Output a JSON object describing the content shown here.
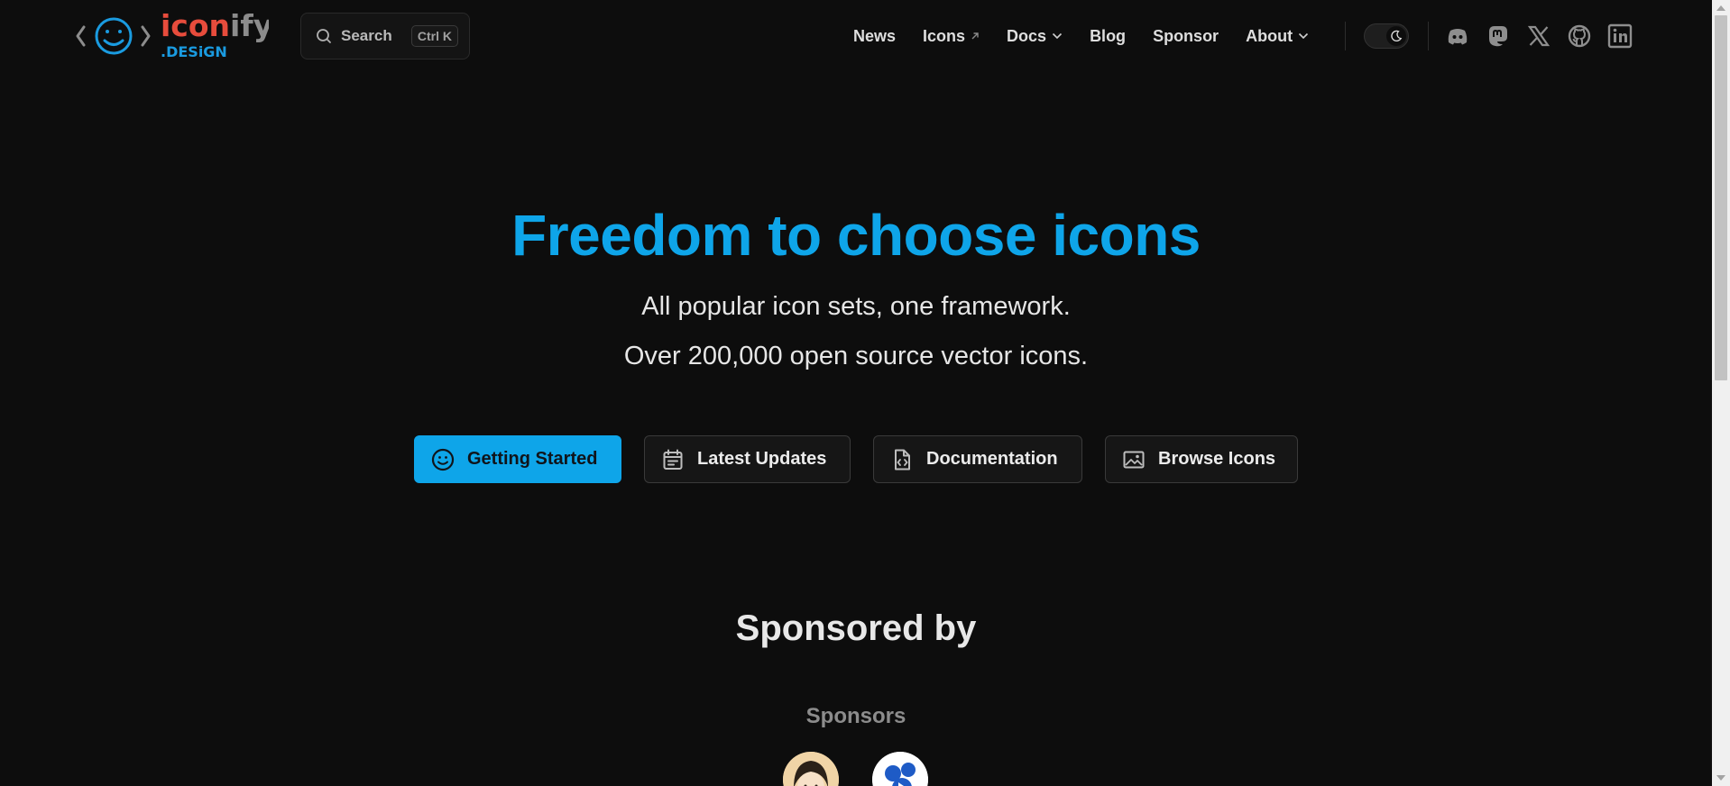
{
  "brand": {
    "logo_word_1": "icon",
    "logo_word_2": "ify",
    "logo_sub": ".DESiGN",
    "colors": {
      "blue": "#1a9be0",
      "red": "#e74c3c",
      "gray": "#8c8c8c"
    }
  },
  "search": {
    "placeholder": "Search",
    "shortcut": "Ctrl K"
  },
  "nav": {
    "links": [
      {
        "label": "News"
      },
      {
        "label": "Icons",
        "icon": "external-arrow-icon"
      },
      {
        "label": "Docs",
        "icon": "chevron-down-icon"
      },
      {
        "label": "Blog"
      },
      {
        "label": "Sponsor"
      },
      {
        "label": "About",
        "icon": "chevron-down-icon"
      }
    ],
    "theme_toggle": {
      "state": "dark",
      "icon": "moon-icon"
    },
    "social_icons": [
      "discord-icon",
      "mastodon-icon",
      "x-twitter-icon",
      "github-icon",
      "linkedin-icon"
    ]
  },
  "hero": {
    "title": "Freedom to choose icons",
    "subtitle_1": "All popular icon sets, one framework.",
    "subtitle_2": "Over 200,000 open source vector icons.",
    "accent": "#0ea5e9"
  },
  "actions": [
    {
      "label": "Getting Started",
      "icon": "smiley-icon",
      "primary": true
    },
    {
      "label": "Latest Updates",
      "icon": "calendar-icon"
    },
    {
      "label": "Documentation",
      "icon": "code-document-icon"
    },
    {
      "label": "Browse Icons",
      "icon": "image-icon"
    }
  ],
  "sponsors": {
    "heading": "Sponsored by",
    "label": "Sponsors"
  }
}
